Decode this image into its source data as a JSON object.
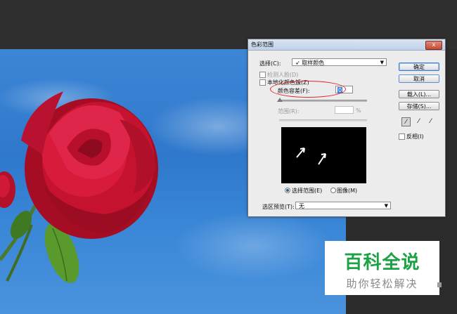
{
  "dialog": {
    "title": "色彩范围",
    "close": "x",
    "select_label": "选择(C):",
    "select_value": "取样颜色",
    "detect_faces": "检测人脸(D)",
    "localized_clusters": "本地化颜色簇(Z)",
    "fuzziness_label": "颜色容差(F):",
    "fuzziness_value": "0",
    "range_label": "范围(R):",
    "range_unit": "%",
    "radio_selection": "选择范围(E)",
    "radio_image": "图像(M)",
    "preview_label": "选区预览(T):",
    "preview_value": "无",
    "buttons": {
      "ok": "确定",
      "cancel": "取消",
      "load": "载入(L)...",
      "save": "存储(S)..."
    },
    "invert_label": "反相(I)",
    "icons": [
      "eyedropper-icon",
      "eyedropper-plus-icon",
      "eyedropper-minus-icon"
    ]
  },
  "watermark": {
    "line1": "百科全说",
    "line2": "助你轻松解决"
  },
  "colors": {
    "highlight": "#e02a2a",
    "watermark_green": "#1aa245"
  }
}
